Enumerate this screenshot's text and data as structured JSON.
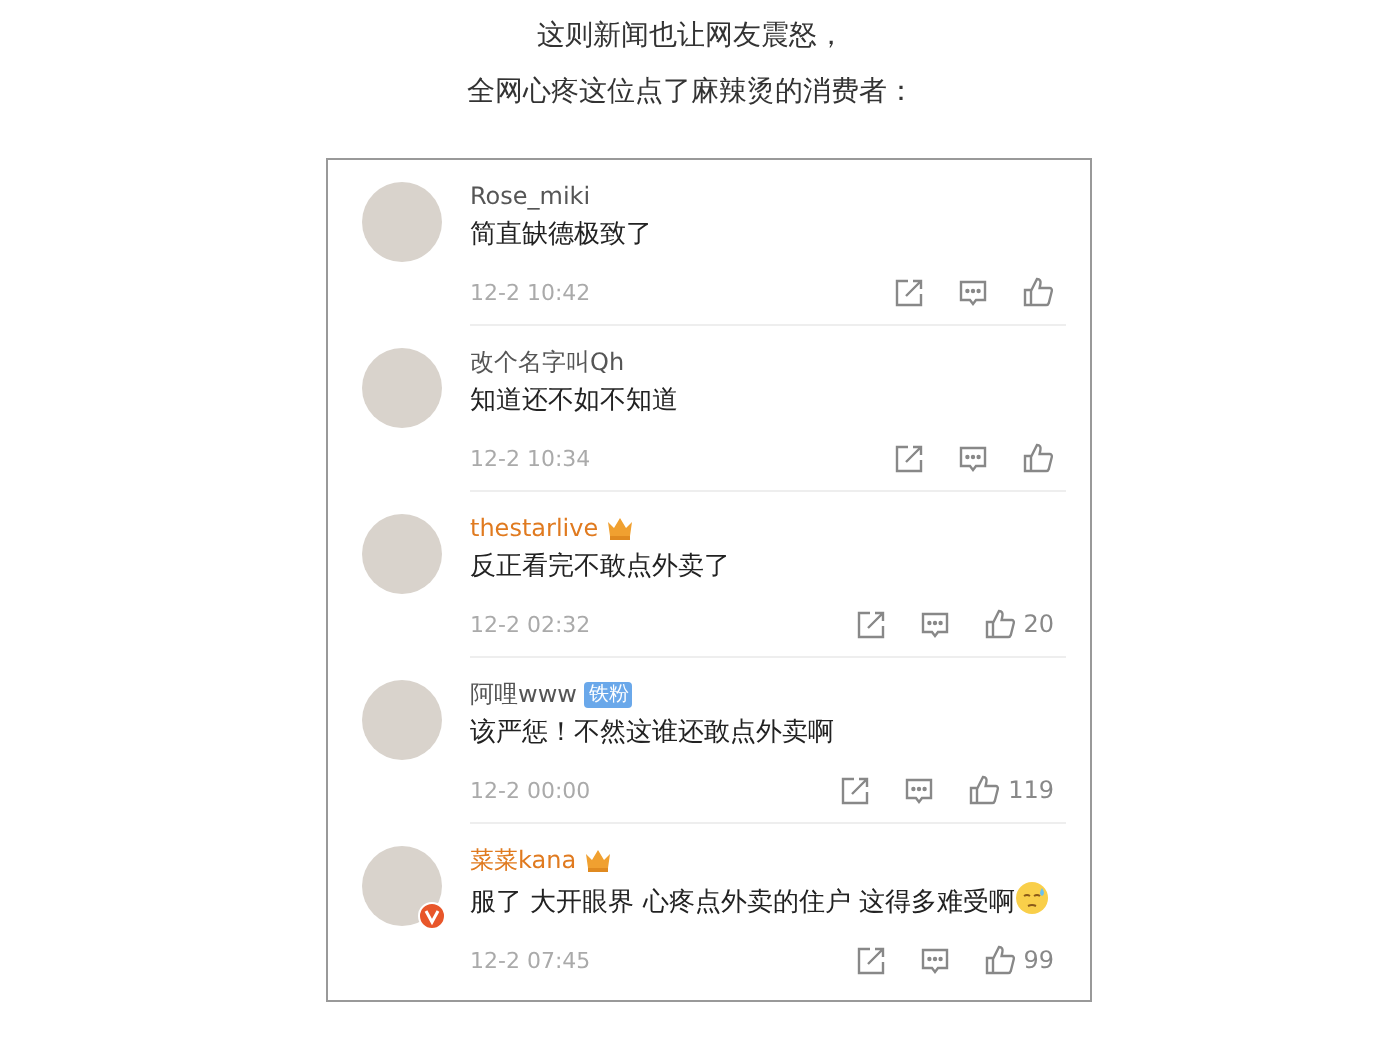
{
  "caption": [
    "这则新闻也让网友震怒，",
    "全网心疼这位点了麻辣烫的消费者："
  ],
  "comments": [
    {
      "name": "Rose_miki",
      "vip": false,
      "verified": false,
      "text": "简直缺德极致了",
      "emoji": false,
      "time": "12-2 10:42"
    },
    {
      "name": "改个名字叫Qh",
      "vip": false,
      "verified": false,
      "text": "知道还不如不知道",
      "emoji": false,
      "time": "12-2 10:34"
    },
    {
      "name": "thestarlive",
      "vip": true,
      "verified": false,
      "text": "反正看完不敢点外卖了",
      "emoji": false,
      "time": "12-2 02:32",
      "likes": "20"
    },
    {
      "name": "阿哩www",
      "vip": false,
      "badge": "铁粉",
      "verified": false,
      "text": "该严惩！不然这谁还敢点外卖啊",
      "emoji": false,
      "time": "12-2 00:00",
      "likes": "119"
    },
    {
      "name": "菜菜kana",
      "vip": true,
      "verified": true,
      "text": "服了 大开眼界 心疼点外卖的住户 这得多难受啊",
      "emoji": true,
      "time": "12-2 07:45",
      "likes": "99"
    }
  ]
}
